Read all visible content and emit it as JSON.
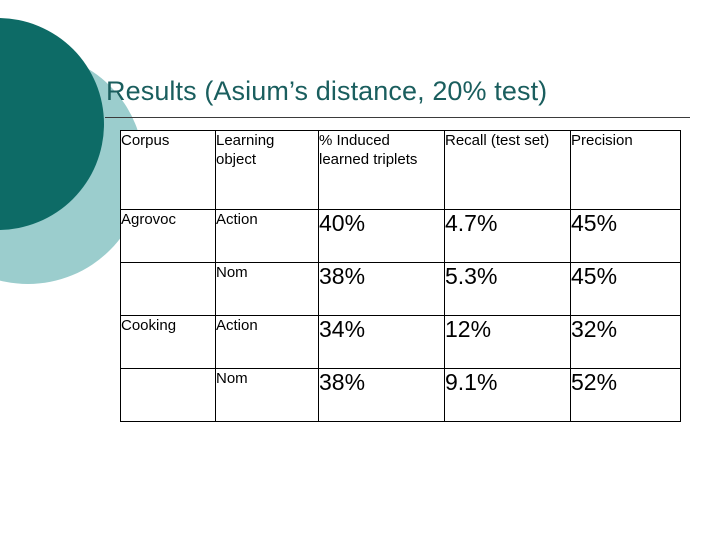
{
  "slide": {
    "title": "Results (Asium’s distance, 20% test)",
    "title_color": "#1a5e5e",
    "background_color": "#ffffff"
  },
  "decoration": {
    "dark_circle_color": "#0d6b66",
    "light_circle_color": "#9bcdcd",
    "dark_circle_name": "dark-teal-circle",
    "light_circle_name": "light-teal-circle"
  },
  "table": {
    "headers": [
      "Corpus",
      "Learning object",
      "% Induced learned triplets",
      "Recall (test set)",
      "Precision"
    ],
    "rows": [
      {
        "corpus": "Agrovoc",
        "learning_object": "Action",
        "induced_learned_triplets": "40%",
        "recall_test_set": "4.7%",
        "precision": "45%"
      },
      {
        "corpus": "",
        "learning_object": "Nom",
        "induced_learned_triplets": "38%",
        "recall_test_set": "5.3%",
        "precision": "45%"
      },
      {
        "corpus": "Cooking",
        "learning_object": "Action",
        "induced_learned_triplets": "34%",
        "recall_test_set": "12%",
        "precision": "32%"
      },
      {
        "corpus": "",
        "learning_object": "Nom",
        "induced_learned_triplets": "38%",
        "recall_test_set": "9.1%",
        "precision": "52%"
      }
    ]
  }
}
